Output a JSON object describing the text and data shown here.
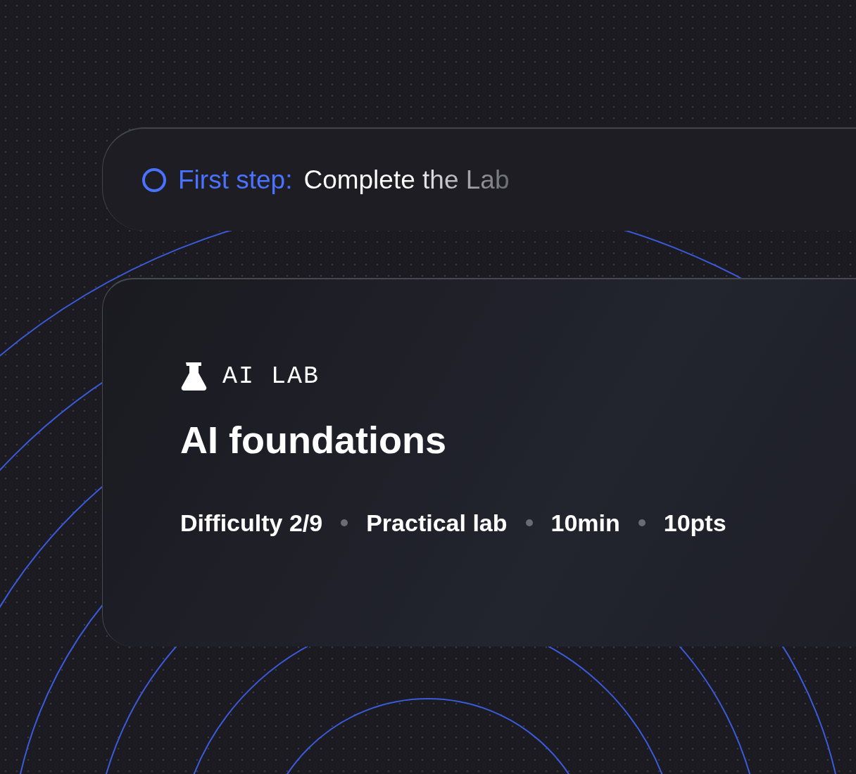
{
  "step": {
    "label": "First step:",
    "text": "Complete the Lab",
    "completed": false
  },
  "card": {
    "category": "AI LAB",
    "title": "AI foundations",
    "meta": [
      "Difficulty 2/9",
      "Practical lab",
      "10min",
      "10pts"
    ]
  }
}
